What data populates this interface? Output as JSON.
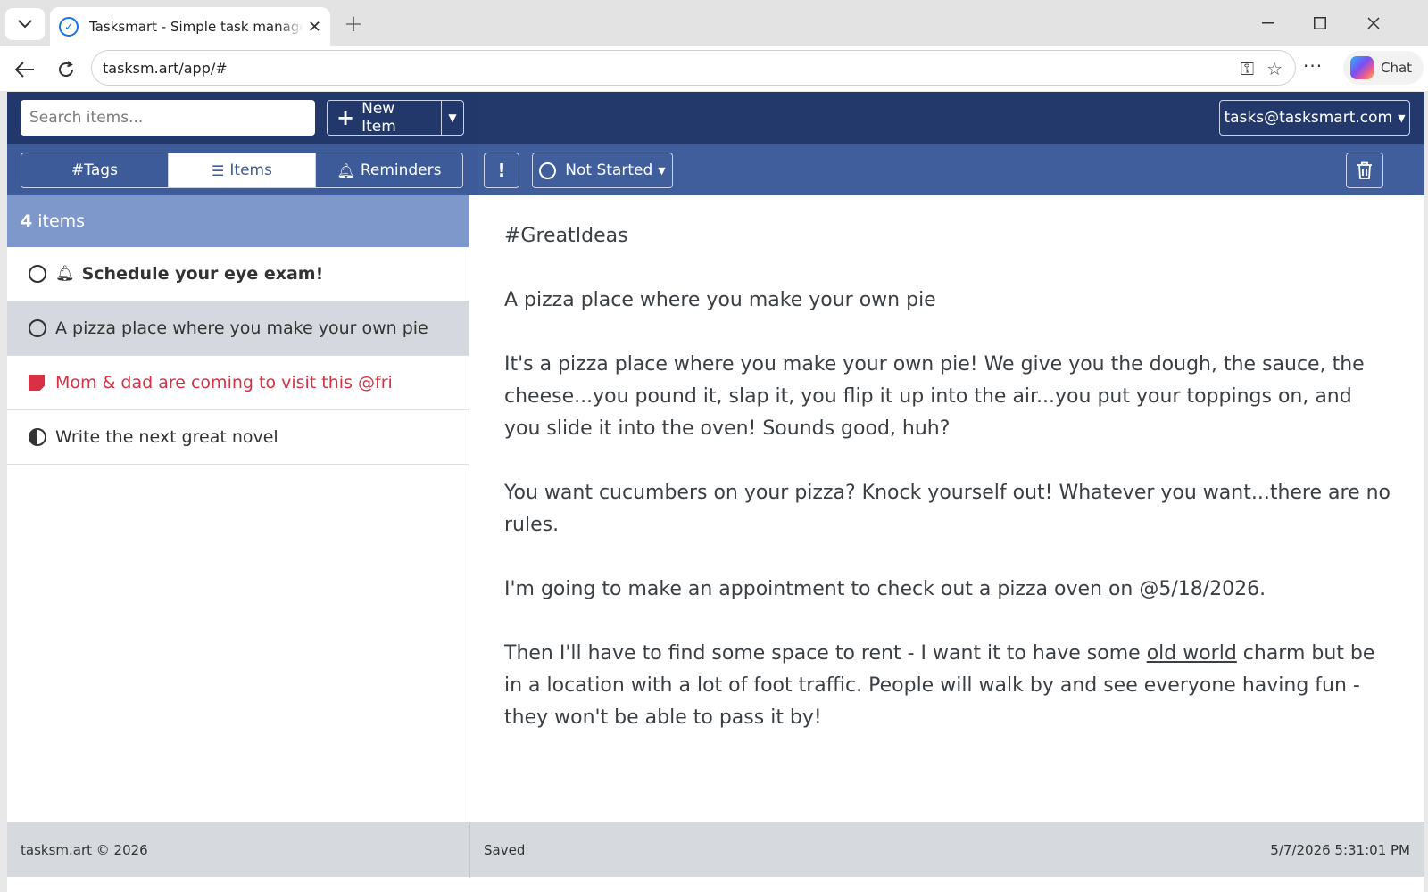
{
  "browser": {
    "tab_title": "Tasksmart - Simple task management",
    "url": "tasksm.art/app/#",
    "chat_label": "Chat"
  },
  "header": {
    "search_placeholder": "Search items...",
    "new_item_label": "New Item",
    "account_label": "tasks@tasksmart.com"
  },
  "toolbar": {
    "tabs": [
      {
        "label": "#Tags",
        "icon": "hash"
      },
      {
        "label": "Items",
        "icon": "list-icon"
      },
      {
        "label": "Reminders",
        "icon": "bell-icon"
      }
    ],
    "active_tab": "Items",
    "priority_label": "!",
    "status_label": "Not Started"
  },
  "list": {
    "count": "4",
    "count_suffix": "items",
    "items": [
      {
        "label": "Schedule your eye exam!",
        "status": "not-started",
        "reminder": true,
        "bold": true
      },
      {
        "label": "A pizza place where you make your own pie",
        "status": "not-started",
        "selected": true
      },
      {
        "label": "Mom & dad are coming to visit this @fri",
        "status": "note",
        "color": "#d93044"
      },
      {
        "label": "Write the next great novel",
        "status": "in-progress"
      }
    ]
  },
  "detail": {
    "tag": "#GreatIdeas",
    "title": "A pizza place where you make your own pie",
    "para1": "It's a pizza place where you make your own pie! We give you the dough, the sauce, the cheese...you pound it, slap it, you flip it up into the air...you put your toppings on, and you slide it into the oven! Sounds good, huh?",
    "para2": "You want cucumbers on your pizza? Knock yourself out! Whatever you want...there are no rules.",
    "para3": "I'm going to make an appointment to check out a pizza oven on @5/18/2026.",
    "para4_a": "Then I'll have to find some space to rent - I want it to have some ",
    "para4_link": "old world",
    "para4_b": " charm but be in a location with a lot of foot traffic.  People will walk by and see everyone having fun - they won't be able to pass it by!"
  },
  "footer": {
    "copyright": "tasksm.art © 2026",
    "status": "Saved",
    "timestamp": "5/7/2026 5:31:01 PM"
  },
  "colors": {
    "header_bg": "#24396b",
    "toolbar_bg": "#415e9c",
    "count_bar_bg": "#7e98cc",
    "selected_row_bg": "#d5d8de",
    "accent_red": "#d93044"
  }
}
